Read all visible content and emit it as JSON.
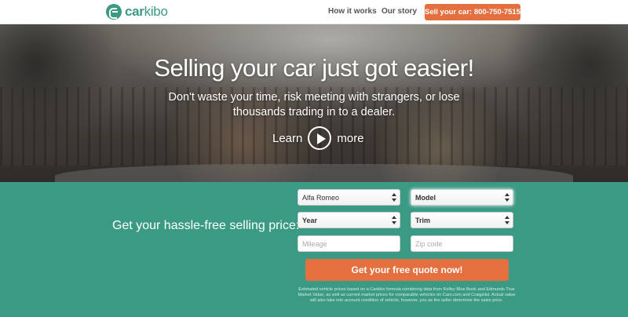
{
  "header": {
    "logo_text_bold": "car",
    "logo_text_light": "kibo",
    "nav": [
      {
        "label": "How it works"
      },
      {
        "label": "Our story"
      }
    ],
    "sell_button_label": "Sell your car: 800-750-7515",
    "logo_icon": "carkibo-logo-icon"
  },
  "hero": {
    "title": "Selling your car just got easier!",
    "subtitle": "Don't waste your time, risk meeting with strangers, or lose thousands trading in to a dealer.",
    "learn_prefix": "Learn",
    "learn_suffix": "more",
    "play_icon": "play-icon"
  },
  "form": {
    "label": "Get your hassle-free selling price:",
    "make_value": "Alfa Romeo",
    "model_value": "Model",
    "year_value": "Year",
    "trim_value": "Trim",
    "mileage_placeholder": "Mileage",
    "zip_placeholder": "Zip code",
    "submit_label": "Get your free quote now!",
    "disclaimer": "Estimated vehicle prices based on a Carkibo formula combining data from Kelley Blue Book and Edmunds True Market Value, as well as current market prices for comparable vehicles on Cars.com and Craigslist. Actual value will also take into account condition of vehicle, however, you as the seller determine the sales price."
  },
  "colors": {
    "brand_green": "#3a9a84",
    "accent_orange": "#e5703f"
  }
}
